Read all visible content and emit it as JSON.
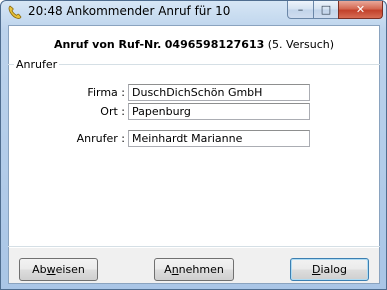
{
  "window": {
    "title": "20:48 Ankommender Anruf für 10",
    "controls": {
      "minimize": "–",
      "maximize": "□",
      "close": "✕"
    },
    "title_icon": "phone-icon"
  },
  "caller": {
    "prefix": "Anruf von Ruf-Nr.",
    "number": "0496598127613",
    "attempt": "(5. Versuch)"
  },
  "group": {
    "title": "Anrufer"
  },
  "fields": {
    "firma": {
      "label": "Firma :",
      "value": "DuschDichSchön GmbH"
    },
    "ort": {
      "label": "Ort :",
      "value": "Papenburg"
    },
    "anrufer": {
      "label": "Anrufer :",
      "value": "Meinhardt Marianne"
    }
  },
  "buttons": {
    "abweisen": {
      "pre": "Ab",
      "mnemonic": "w",
      "post": "eisen"
    },
    "annehmen": {
      "pre": "A",
      "mnemonic": "n",
      "post": "nehmen"
    },
    "dialog": {
      "pre": "",
      "mnemonic": "D",
      "post": "ialog"
    }
  },
  "colors": {
    "close_button": "#c2412b",
    "frame": "#a9c5e6"
  }
}
